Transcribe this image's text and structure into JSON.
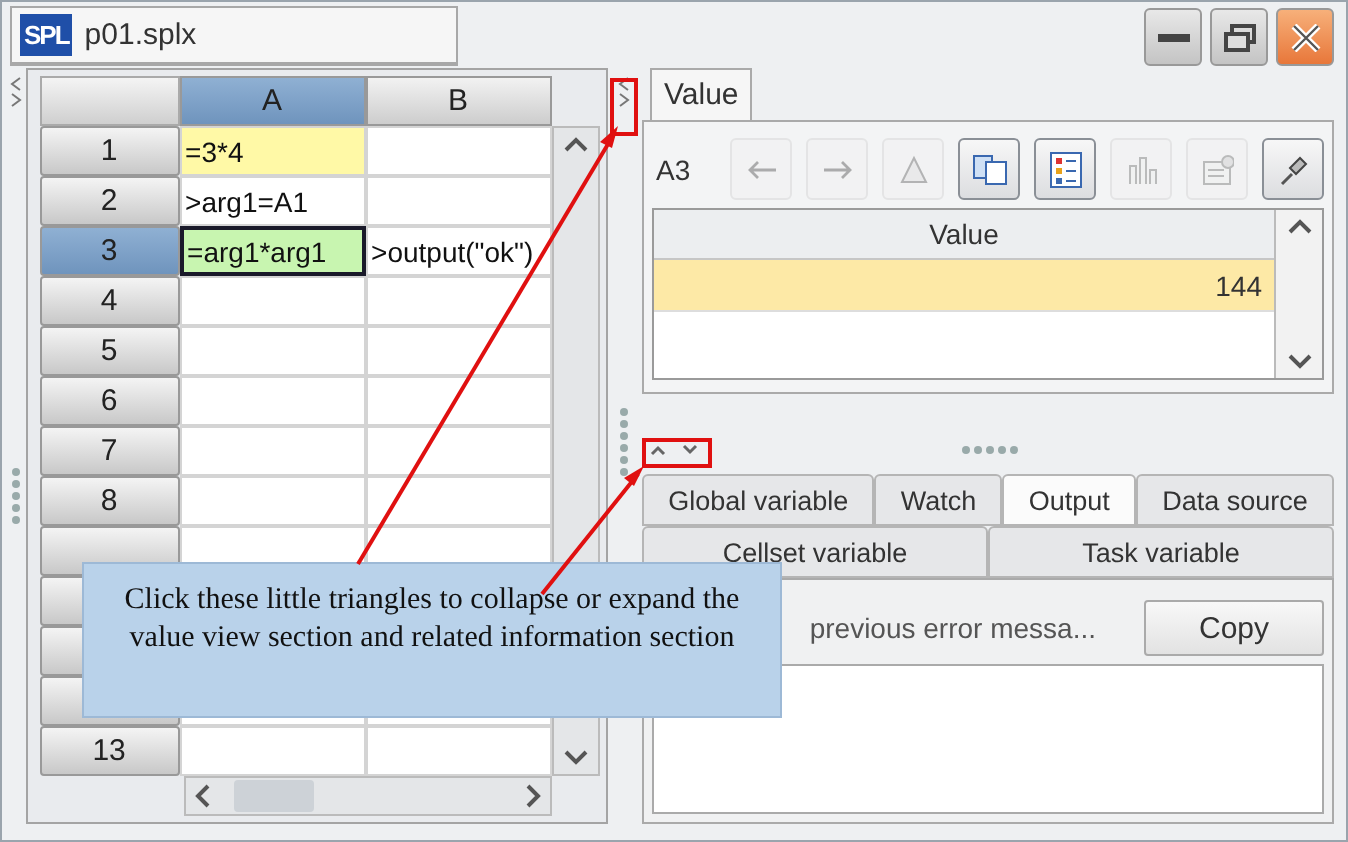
{
  "document_tab": {
    "logo": "SPL",
    "title": "p01.splx"
  },
  "grid": {
    "columns": [
      {
        "label": "A",
        "selected": true
      },
      {
        "label": "B",
        "selected": false
      }
    ],
    "rows": [
      {
        "label": "1",
        "selected": false,
        "cells": [
          {
            "text": "=3*4",
            "color": "#fff9a6",
            "selected": false
          },
          {
            "text": "",
            "selected": false
          }
        ]
      },
      {
        "label": "2",
        "selected": false,
        "cells": [
          {
            "text": ">arg1=A1",
            "selected": false
          },
          {
            "text": "",
            "selected": false
          }
        ]
      },
      {
        "label": "3",
        "selected": true,
        "cells": [
          {
            "text": "=arg1*arg1",
            "color": "#c8f5b0",
            "selected": true
          },
          {
            "text": ">output(\"ok\")",
            "selected": false
          }
        ]
      },
      {
        "label": "4",
        "selected": false,
        "cells": [
          {
            "selected": false
          },
          {
            "selected": false
          }
        ]
      },
      {
        "label": "5",
        "selected": false,
        "cells": [
          {
            "selected": false
          },
          {
            "selected": false
          }
        ]
      },
      {
        "label": "6",
        "selected": false,
        "cells": [
          {
            "selected": false
          },
          {
            "selected": false
          }
        ]
      },
      {
        "label": "7",
        "selected": false,
        "cells": [
          {
            "selected": false
          },
          {
            "selected": false
          }
        ]
      },
      {
        "label": "8",
        "selected": false,
        "cells": [
          {
            "selected": false
          },
          {
            "selected": false
          }
        ]
      },
      {
        "selected": false,
        "cells": [
          {
            "selected": false
          },
          {
            "selected": false
          }
        ]
      },
      {
        "selected": false
      },
      {
        "selected": false
      },
      {
        "selected": false,
        "cells": [
          {
            "selected": false
          },
          {
            "selected": false
          }
        ]
      },
      {
        "label": "13",
        "selected": false,
        "cells": [
          {
            "selected": false
          },
          {
            "selected": false
          }
        ]
      }
    ]
  },
  "value_panel": {
    "tab": "Value",
    "cell_ref": "A3",
    "toolbar": [
      {
        "kind": "back",
        "disabled": true
      },
      {
        "kind": "forward",
        "disabled": true
      },
      {
        "kind": "triangle",
        "disabled": true
      },
      {
        "kind": "copy",
        "disabled": false
      },
      {
        "kind": "list",
        "disabled": false
      },
      {
        "kind": "chart",
        "disabled": true
      },
      {
        "kind": "properties",
        "disabled": true
      },
      {
        "kind": "pin",
        "disabled": false
      }
    ],
    "table": {
      "column": "Value",
      "rows": [
        {
          "value": "144",
          "selected": true
        }
      ]
    }
  },
  "info_tabs": [
    [
      {
        "label": "Global variable",
        "selected": false
      },
      {
        "label": "Watch",
        "selected": false
      },
      {
        "label": "Output",
        "selected": true
      },
      {
        "label": "Data source",
        "selected": false
      }
    ],
    [
      {
        "label": "Cellset variable",
        "selected": false
      },
      {
        "label": "Task variable",
        "selected": false
      }
    ]
  ],
  "output": {
    "message": "previous error messa...",
    "button": "Copy"
  },
  "callout": "Click these little triangles to collapse or expand the value view section and related information section"
}
